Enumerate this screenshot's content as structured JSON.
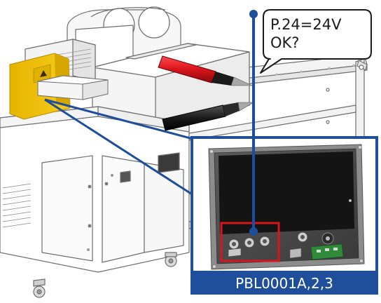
{
  "callout": {
    "line1": "P.24=24V",
    "line2": "OK?"
  },
  "inset": {
    "caption": "PBL0001A,2,3"
  },
  "colors": {
    "highlight_yellow": "#f2c300",
    "leader_blue": "#1d4e9c",
    "caption_bg": "#1f4f9a",
    "probe_red": "#d9141b",
    "probe_black": "#1a1a1a",
    "frame_red": "#d9141b"
  }
}
